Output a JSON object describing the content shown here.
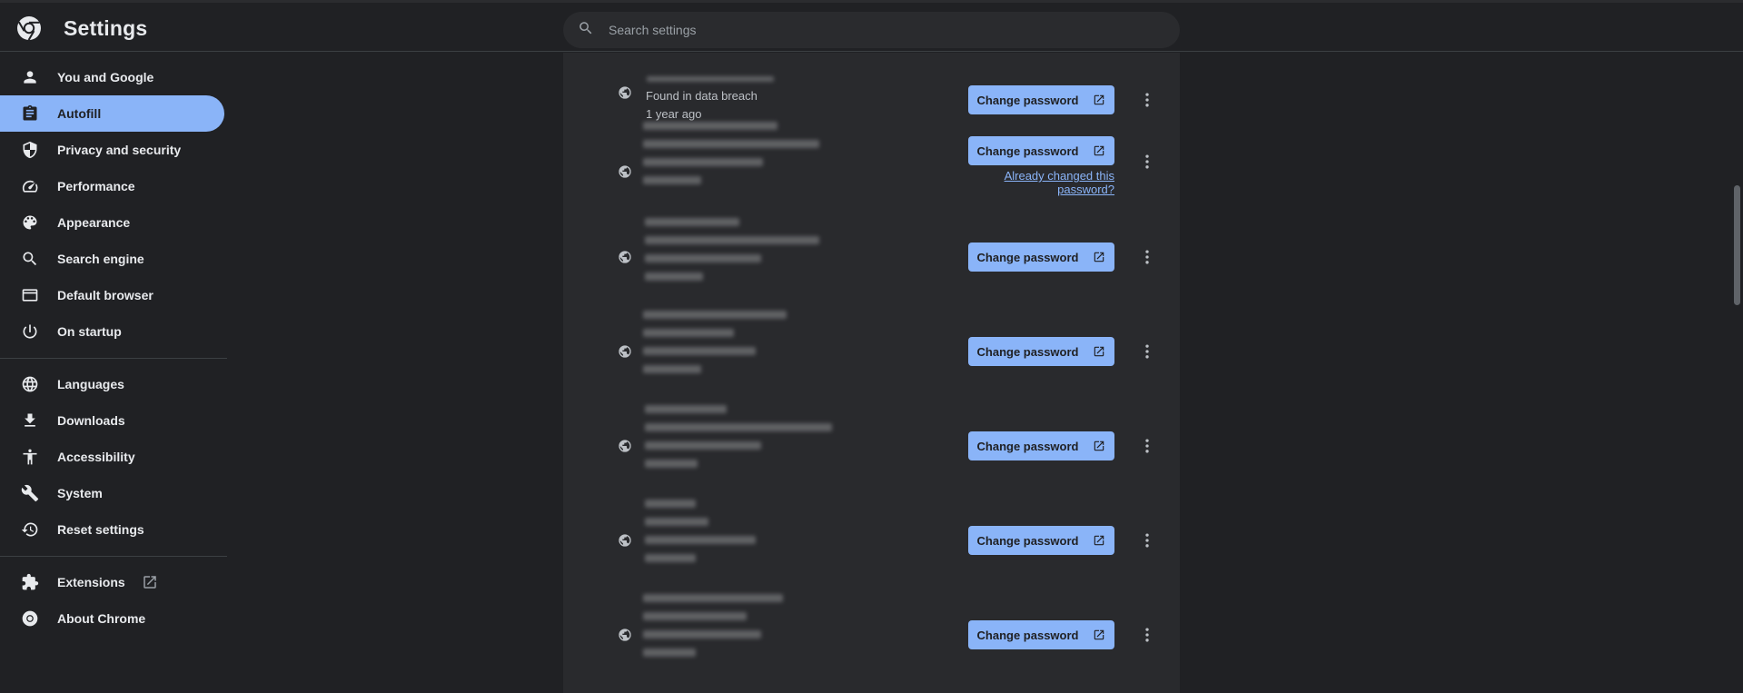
{
  "app": {
    "title": "Settings",
    "logo_icon": "chrome-logo-icon"
  },
  "search": {
    "placeholder": "Search settings",
    "value": ""
  },
  "sidebar": {
    "groups": [
      [
        {
          "label": "You and Google",
          "icon": "person-icon"
        },
        {
          "label": "Autofill",
          "icon": "assignment-icon",
          "active": true
        },
        {
          "label": "Privacy and security",
          "icon": "shield-icon"
        },
        {
          "label": "Performance",
          "icon": "speedometer-icon"
        },
        {
          "label": "Appearance",
          "icon": "palette-icon"
        },
        {
          "label": "Search engine",
          "icon": "search-icon"
        },
        {
          "label": "Default browser",
          "icon": "browser-window-icon"
        },
        {
          "label": "On startup",
          "icon": "power-icon"
        }
      ],
      [
        {
          "label": "Languages",
          "icon": "globe-icon"
        },
        {
          "label": "Downloads",
          "icon": "download-icon"
        },
        {
          "label": "Accessibility",
          "icon": "accessibility-icon"
        },
        {
          "label": "System",
          "icon": "wrench-icon"
        },
        {
          "label": "Reset settings",
          "icon": "history-icon"
        }
      ],
      [
        {
          "label": "Extensions",
          "icon": "puzzle-icon",
          "external": true
        },
        {
          "label": "About Chrome",
          "icon": "chrome-icon"
        }
      ]
    ]
  },
  "password_rows": [
    {
      "lines": [
        "Found in data breach",
        "1 year ago"
      ]
    },
    {
      "already_changed_link": "Already changed this password?"
    },
    {},
    {},
    {},
    {},
    {}
  ],
  "labels": {
    "change_password": "Change password"
  },
  "colors": {
    "accent": "#8ab4f8",
    "background": "#202124",
    "card": "#292a2d"
  }
}
